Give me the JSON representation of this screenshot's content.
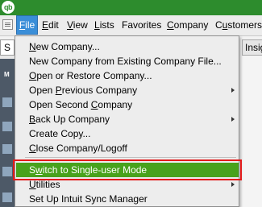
{
  "logo": "qb",
  "menubar": {
    "items": [
      "File",
      "Edit",
      "View",
      "Lists",
      "Favorites",
      "Company",
      "Customers"
    ],
    "mnemonics": [
      "F",
      "E",
      "V",
      "L",
      "",
      "C",
      "u"
    ]
  },
  "left_panel": {
    "search_text": "S",
    "nav_label": "M"
  },
  "right_panel": {
    "tab_label": "Insig"
  },
  "file_menu": {
    "items": [
      {
        "label": "New Company...",
        "submenu": false
      },
      {
        "label": "New Company from Existing Company File...",
        "submenu": false
      },
      {
        "label": "Open or Restore Company...",
        "submenu": false
      },
      {
        "label": "Open Previous Company",
        "submenu": true
      },
      {
        "label": "Open Second Company",
        "submenu": false
      },
      {
        "label": "Back Up Company",
        "submenu": true
      },
      {
        "label": "Create Copy...",
        "submenu": false
      },
      {
        "label": "Close Company/Logoff",
        "submenu": false
      },
      {
        "label": "Switch to Single-user Mode",
        "submenu": false
      },
      {
        "label": "Utilities",
        "submenu": true
      },
      {
        "label": "Set Up Intuit Sync Manager",
        "submenu": false
      }
    ],
    "highlighted": "Switch to Single-user Mode"
  },
  "colors": {
    "title_bar": "#2d8c2d",
    "active_menu": "#3a8ed8",
    "highlight_green": "#48a21c",
    "highlight_border": "#e31a1a"
  }
}
